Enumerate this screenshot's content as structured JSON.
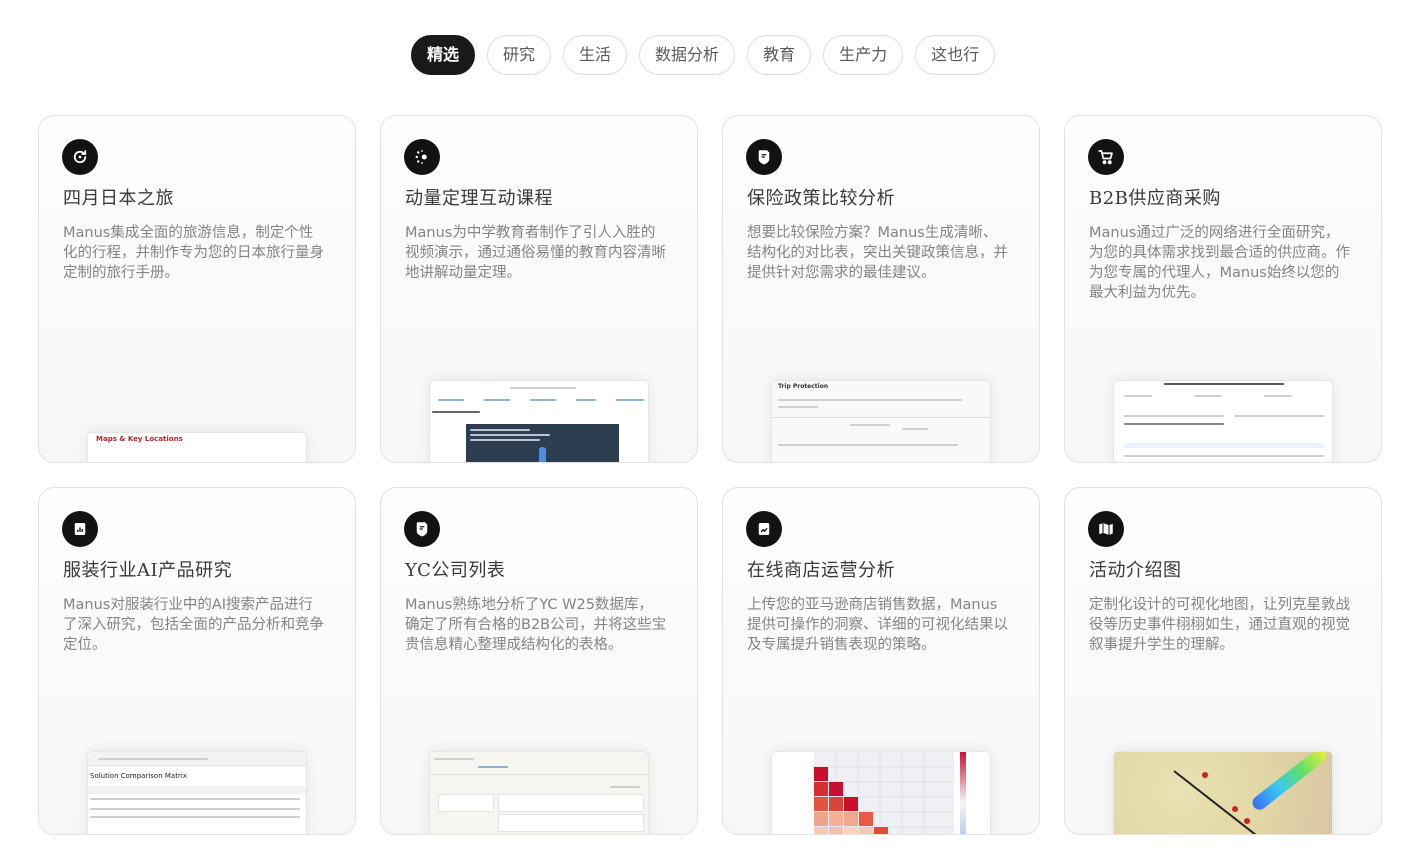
{
  "tabs": [
    {
      "label": "精选",
      "active": true
    },
    {
      "label": "研究",
      "active": false
    },
    {
      "label": "生活",
      "active": false
    },
    {
      "label": "数据分析",
      "active": false
    },
    {
      "label": "教育",
      "active": false
    },
    {
      "label": "生产力",
      "active": false
    },
    {
      "label": "这也行",
      "active": false
    }
  ],
  "cards": [
    {
      "icon": "refresh-circle-icon",
      "title": "四月日本之旅",
      "description": "Manus集成全面的旅游信息，制定个性化的行程，并制作专为您的日本旅行量身定制的旅行手册。",
      "preview": {
        "heading": "Maps & Key Locations"
      }
    },
    {
      "icon": "sparkle-burst-icon",
      "title": "动量定理互动课程",
      "description": "Manus为中学教育者制作了引人入胜的视频演示，通过通俗易懂的教育内容清晰地讲解动量定理。",
      "preview": {}
    },
    {
      "icon": "shield-document-icon",
      "title": "保险政策比较分析",
      "description": "想要比较保险方案？Manus生成清晰、结构化的对比表，突出关键政策信息，并提供针对您需求的最佳建议。",
      "preview": {
        "heading": "Trip Protection"
      }
    },
    {
      "icon": "shopping-cart-icon",
      "title": "B2B供应商采购",
      "description": "Manus通过广泛的网络进行全面研究，为您的具体需求找到最合适的供应商。作为您专属的代理人，Manus始终以您的最大利益为优先。",
      "preview": {}
    },
    {
      "icon": "report-chart-icon",
      "title": "服装行业AI产品研究",
      "description": "Manus对服装行业中的AI搜索产品进行了深入研究，包括全面的产品分析和竞争定位。",
      "preview": {
        "heading": "Solution Comparison Matrix"
      }
    },
    {
      "icon": "shield-document-icon",
      "title": "YC公司列表",
      "description": "Manus熟练地分析了YC W25数据库，确定了所有合格的B2B公司，并将这些宝贵信息精心整理成结构化的表格。",
      "preview": {}
    },
    {
      "icon": "trending-chart-icon",
      "title": "在线商店运营分析",
      "description": "上传您的亚马逊商店销售数据，Manus提供可操作的洞察、详细的可视化结果以及专属提升销售表现的策略。",
      "preview": {}
    },
    {
      "icon": "map-pin-icon",
      "title": "活动介绍图",
      "description": "定制化设计的可视化地图，让列克星敦战役等历史事件栩栩如生，通过直观的视觉叙事提升学生的理解。",
      "preview": {}
    }
  ]
}
